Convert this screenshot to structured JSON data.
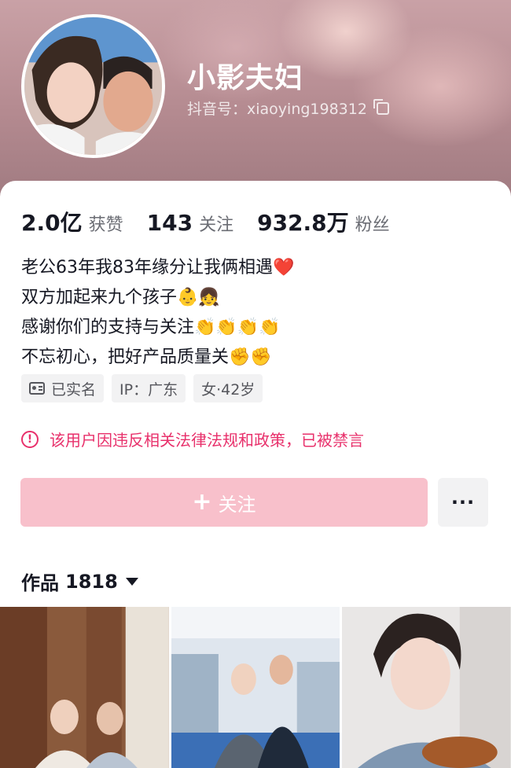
{
  "profile": {
    "nickname": "小影夫妇",
    "douyin_id": "抖音号：xiaoying198312"
  },
  "stats": [
    {
      "num": "2.0亿",
      "label": "获赞"
    },
    {
      "num": "143",
      "label": "关注"
    },
    {
      "num": "932.8万",
      "label": "粉丝"
    }
  ],
  "bio": [
    "老公63年我83年缘分让我俩相遇❤️",
    "双方加起来九个孩子👶👧",
    "感谢你们的支持与关注👏👏👏👏",
    "不忘初心，把好产品质量关✊✊"
  ],
  "tags": {
    "verified": "已实名",
    "ip": "IP：广东",
    "gender_age": "女·42岁"
  },
  "ban_notice": "该用户因违反相关法律法规和政策，已被禁言",
  "actions": {
    "follow_label": "关注",
    "more_label": "···"
  },
  "works": {
    "label": "作品",
    "count": "1818"
  },
  "icons": {
    "copy": "copy-icon",
    "id_card": "id-card-icon",
    "warning": "warning-icon",
    "plus": "plus-icon",
    "caret": "caret-down-icon"
  },
  "colors": {
    "accent_pink": "#f8c0cb",
    "warning_red": "#e8306b",
    "text_primary": "#161823",
    "text_secondary": "#6b6d74"
  }
}
